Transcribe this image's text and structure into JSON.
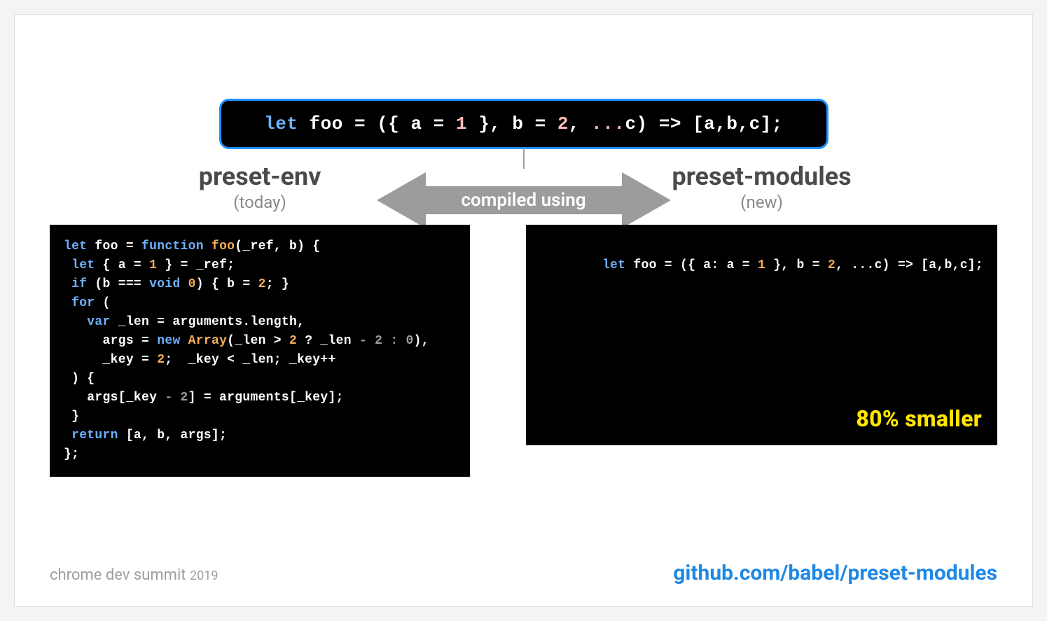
{
  "source_code": {
    "tokens": [
      {
        "t": "let ",
        "c": "kw"
      },
      {
        "t": "foo = ({ a = "
      },
      {
        "t": "1",
        "c": "num"
      },
      {
        "t": " }, b = "
      },
      {
        "t": "2",
        "c": "num"
      },
      {
        "t": ", "
      },
      {
        "t": "...",
        "c": "spread"
      },
      {
        "t": "c) => [a,b,c];"
      }
    ]
  },
  "arrow_label": "compiled using",
  "left": {
    "title": "preset-env",
    "subtitle": "(today)",
    "code_tokens": [
      {
        "t": "let ",
        "c": "kw"
      },
      {
        "t": "foo = "
      },
      {
        "t": "function ",
        "c": "kw"
      },
      {
        "t": "foo",
        "c": "fn"
      },
      {
        "t": "(_ref, b) {\n"
      },
      {
        "t": " let ",
        "c": "kw"
      },
      {
        "t": "{ a = "
      },
      {
        "t": "1",
        "c": "num"
      },
      {
        "t": " } = _ref;\n"
      },
      {
        "t": " if ",
        "c": "kw"
      },
      {
        "t": "(b === "
      },
      {
        "t": "void ",
        "c": "kw"
      },
      {
        "t": "0",
        "c": "num"
      },
      {
        "t": ") { b = "
      },
      {
        "t": "2",
        "c": "num"
      },
      {
        "t": "; }\n"
      },
      {
        "t": " for ",
        "c": "kw"
      },
      {
        "t": "(\n"
      },
      {
        "t": "   var ",
        "c": "kw"
      },
      {
        "t": "_len = arguments.length,\n"
      },
      {
        "t": "     args = "
      },
      {
        "t": "new ",
        "c": "kw"
      },
      {
        "t": "Array",
        "c": "fn"
      },
      {
        "t": "(_len > "
      },
      {
        "t": "2",
        "c": "num"
      },
      {
        "t": " ? _len "
      },
      {
        "t": "- 2 : 0",
        "c": "dim"
      },
      {
        "t": "),\n"
      },
      {
        "t": "     _key = "
      },
      {
        "t": "2",
        "c": "num"
      },
      {
        "t": ";  _key < _len; _key++\n"
      },
      {
        "t": " ) {\n"
      },
      {
        "t": "   args[_key "
      },
      {
        "t": "- 2",
        "c": "dim"
      },
      {
        "t": "] = arguments[_key];\n"
      },
      {
        "t": " }\n"
      },
      {
        "t": " return ",
        "c": "kw"
      },
      {
        "t": "[a, b, args];\n"
      },
      {
        "t": "};"
      }
    ]
  },
  "right": {
    "title": "preset-modules",
    "subtitle": "(new)",
    "code_tokens": [
      {
        "t": "let ",
        "c": "kw"
      },
      {
        "t": "foo = ({ a: a = "
      },
      {
        "t": "1",
        "c": "num"
      },
      {
        "t": " }, b = "
      },
      {
        "t": "2",
        "c": "num"
      },
      {
        "t": ", ...c) => [a,b,c];"
      }
    ],
    "badge": "80% smaller"
  },
  "footer": {
    "event_name": "chrome dev summit",
    "event_year": "2019",
    "link": "github.com/babel/preset-modules"
  }
}
